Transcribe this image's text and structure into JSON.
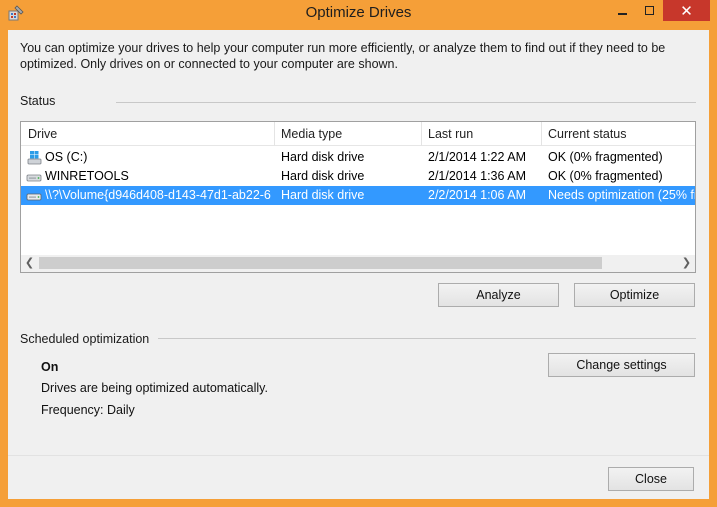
{
  "window": {
    "title": "Optimize Drives",
    "accent_color": "#f59f38",
    "close_color": "#c7372b",
    "controls": {
      "minimize_icon": "minimize-icon",
      "maximize_icon": "maximize-icon",
      "close_glyph": "✕"
    }
  },
  "intro_text": "You can optimize your drives to help your computer run more efficiently, or analyze them to find out if they need to be optimized. Only drives on or connected to your computer are shown.",
  "status": {
    "label": "Status",
    "columns": [
      "Drive",
      "Media type",
      "Last run",
      "Current status"
    ],
    "rows": [
      {
        "icon": "windows-drive-icon",
        "drive": "OS (C:)",
        "media": "Hard disk drive",
        "last_run": "2/1/2014 1:22 AM",
        "status": "OK (0% fragmented)",
        "selected": false
      },
      {
        "icon": "hard-drive-icon",
        "drive": "WINRETOOLS",
        "media": "Hard disk drive",
        "last_run": "2/1/2014 1:36 AM",
        "status": "OK (0% fragmented)",
        "selected": false
      },
      {
        "icon": "hard-drive-icon",
        "drive": "\\\\?\\Volume{d946d408-d143-47d1-ab22-6...",
        "media": "Hard disk drive",
        "last_run": "2/2/2014 1:06 AM",
        "status": "Needs optimization (25% fra",
        "selected": true
      }
    ],
    "selection_color": "#3399ff"
  },
  "buttons": {
    "analyze": "Analyze",
    "optimize": "Optimize",
    "change_settings": "Change settings",
    "close": "Close"
  },
  "scheduled": {
    "label": "Scheduled optimization",
    "state": "On",
    "description": "Drives are being optimized automatically.",
    "frequency": "Frequency: Daily"
  }
}
